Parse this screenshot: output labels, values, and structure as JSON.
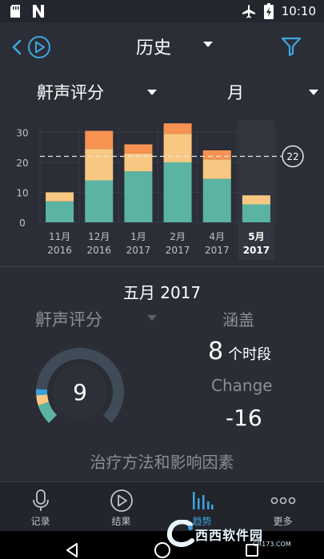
{
  "status_bar": {
    "time": "10:10",
    "left_icons": [
      "sd-card-icon",
      "n-notification-icon"
    ],
    "right_icons": [
      "airplane-icon",
      "battery-charging-icon"
    ]
  },
  "header": {
    "title": "历史"
  },
  "selectors": {
    "metric": "鼾声评分",
    "period": "月"
  },
  "chart_data": {
    "type": "bar",
    "stacked": true,
    "categories": [
      [
        "11月",
        "2016"
      ],
      [
        "12月",
        "2016"
      ],
      [
        "1月",
        "2017"
      ],
      [
        "2月",
        "2017"
      ],
      [
        "4月",
        "2017"
      ],
      [
        "5月",
        "2017"
      ]
    ],
    "selected_index": 5,
    "series": [
      {
        "color": "#5bb3a3",
        "values": [
          7,
          14,
          17,
          20,
          14.5,
          6
        ]
      },
      {
        "color": "#f8c882",
        "values": [
          3,
          10.5,
          6,
          9.5,
          6.5,
          3
        ]
      },
      {
        "color": "#f79250",
        "values": [
          0,
          6,
          3,
          3.5,
          3,
          0
        ]
      }
    ],
    "yticks": [
      0,
      10,
      20,
      30
    ],
    "ylim": [
      0,
      32
    ],
    "reference_line": 22,
    "reference_label": "22",
    "grid": true
  },
  "summary": {
    "title": "五月 2017",
    "metric": "鼾声评分",
    "score": "9",
    "gauge": {
      "fraction": 0.2,
      "track_color": "#3f4b57",
      "segments": [
        {
          "color": "#5bb3a3",
          "fraction": 0.1
        },
        {
          "color": "#f8c882",
          "fraction": 0.05
        },
        {
          "color": "#3aa0dc",
          "fraction": 0.03
        }
      ]
    },
    "coverage_title": "涵盖",
    "coverage_number": "8",
    "coverage_unit": "个时段",
    "change_label": "Change",
    "change_value": "-16",
    "treatments_label": "治疗方法和影响因素"
  },
  "bottom_nav": {
    "items": [
      {
        "label": "记录",
        "icon": "microphone-icon",
        "active": false
      },
      {
        "label": "结果",
        "icon": "play-circle-icon",
        "active": false
      },
      {
        "label": "趋势",
        "icon": "bar-chart-icon",
        "active": true
      },
      {
        "label": "更多",
        "icon": "more-dots-icon",
        "active": false
      }
    ]
  },
  "watermark": {
    "text": "西西软件园",
    "sub": "CR173.COM"
  },
  "colors": {
    "accent": "#3ea6e0",
    "background": "#2b2e37"
  }
}
